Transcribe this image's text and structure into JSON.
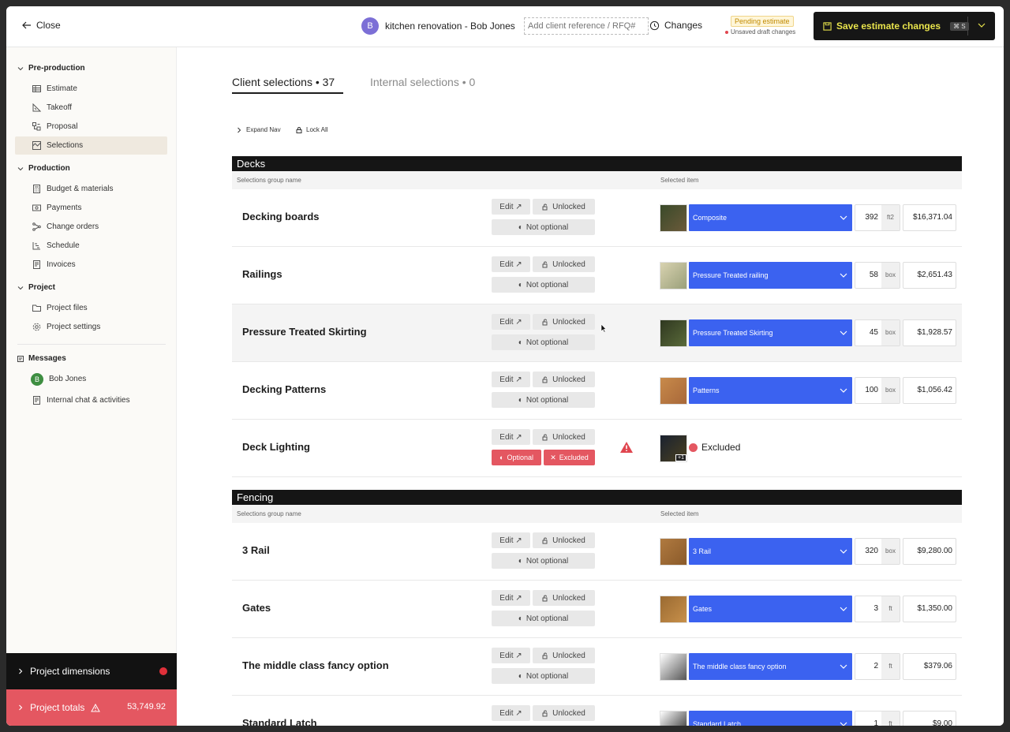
{
  "header": {
    "close_label": "Close",
    "avatar_initial": "B",
    "project_title": "kitchen renovation - Bob Jones",
    "reference_placeholder": "Add client reference / RFQ#",
    "changes_label": "Changes",
    "pending_badge": "Pending estimate",
    "draft_label": "Unsaved draft changes",
    "save_label": "Save estimate changes",
    "save_shortcut": "⌘ S"
  },
  "sidebar": {
    "sections": {
      "preproduction": "Pre-production",
      "production": "Production",
      "project": "Project",
      "messages": "Messages"
    },
    "items": {
      "estimate": "Estimate",
      "takeoff": "Takeoff",
      "proposal": "Proposal",
      "selections": "Selections",
      "budget": "Budget & materials",
      "payments": "Payments",
      "change_orders": "Change orders",
      "schedule": "Schedule",
      "invoices": "Invoices",
      "project_files": "Project files",
      "project_settings": "Project settings",
      "bob_jones": "Bob Jones",
      "bob_initial": "B",
      "internal_chat": "Internal chat & activities"
    },
    "dimensions_label": "Project dimensions",
    "totals_label": "Project totals",
    "totals_value": "53,749.92"
  },
  "main": {
    "tabs": {
      "client": "Client selections • 37",
      "internal": "Internal selections • 0"
    },
    "tools": {
      "expand": "Expand Nav",
      "lock": "Lock All"
    },
    "col_group_name": "Selections group name",
    "col_selected_item": "Selected item",
    "pill_edit": "Edit ↗",
    "pill_unlocked": "Unlocked",
    "pill_not_optional": "Not optional",
    "pill_optional": "Optional",
    "pill_excluded": "Excluded",
    "excluded_status": "Excluded",
    "plus_more": "+1",
    "groups": [
      {
        "title": "Decks",
        "rows": [
          {
            "name": "Decking boards",
            "item": "Composite",
            "qty": "392",
            "unit": "ft2",
            "price": "$16,371.04"
          },
          {
            "name": "Railings",
            "item": "Pressure Treated railing",
            "qty": "58",
            "unit": "box",
            "price": "$2,651.43"
          },
          {
            "name": "Pressure Treated Skirting",
            "item": "Pressure Treated Skirting",
            "qty": "45",
            "unit": "box",
            "price": "$1,928.57"
          },
          {
            "name": "Decking Patterns",
            "item": "Patterns",
            "qty": "100",
            "unit": "box",
            "price": "$1,056.42"
          },
          {
            "name": "Deck Lighting"
          }
        ]
      },
      {
        "title": "Fencing",
        "rows": [
          {
            "name": "3 Rail",
            "item": "3 Rail",
            "qty": "320",
            "unit": "box",
            "price": "$9,280.00"
          },
          {
            "name": "Gates",
            "item": "Gates",
            "qty": "3",
            "unit": "ft",
            "price": "$1,350.00"
          },
          {
            "name": "The middle class fancy option",
            "item": "The middle class fancy option",
            "qty": "2",
            "unit": "ft",
            "price": "$379.06"
          },
          {
            "name": "Standard Latch",
            "item": "Standard Latch",
            "qty": "1",
            "unit": "ft",
            "price": "$9.00"
          }
        ]
      }
    ]
  },
  "colors": {
    "accent_blue": "#3b62f0",
    "excluded_red": "#e45761",
    "save_yellow": "#e9e44c"
  }
}
